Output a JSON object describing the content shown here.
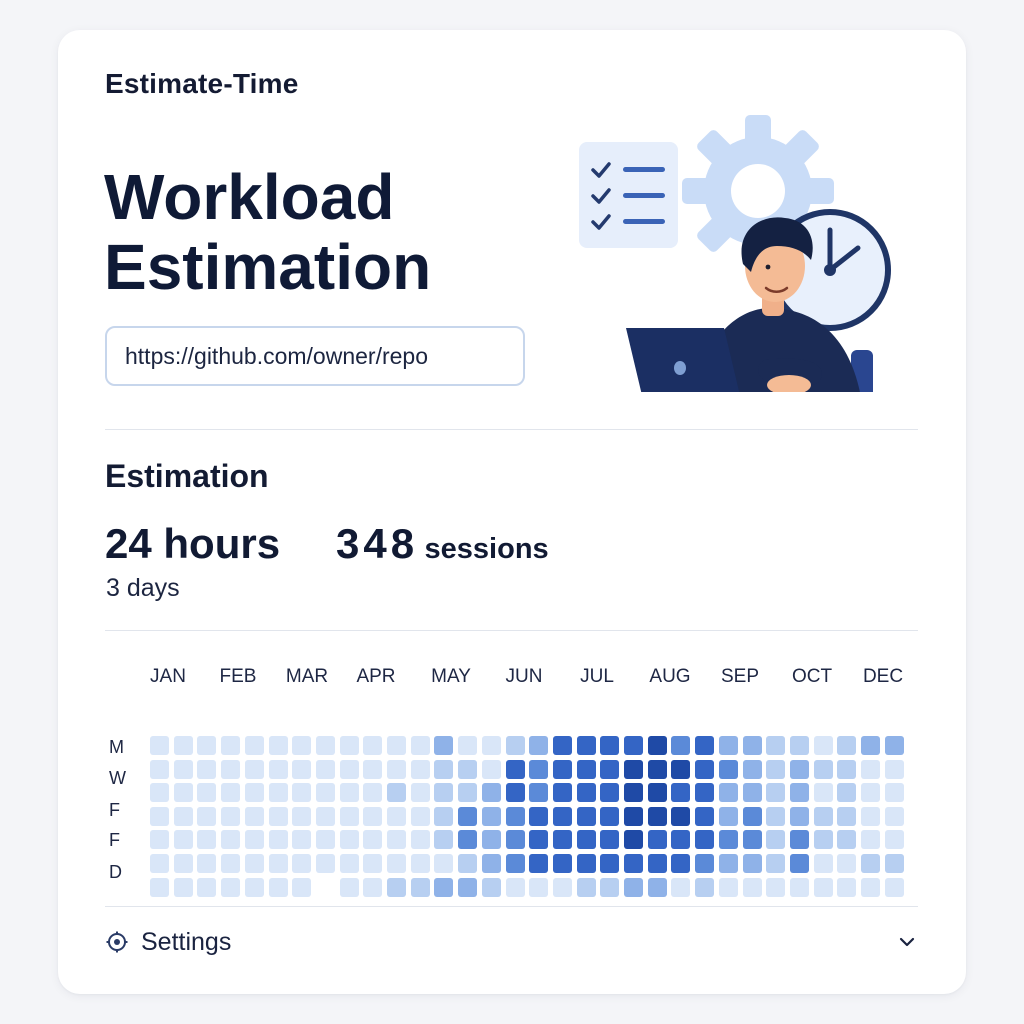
{
  "app": {
    "name": "Estimate-Time"
  },
  "hero": {
    "title_line1": "Workload",
    "title_line2": "Estimation",
    "repo_input_value": "https://github.com/owner/repo"
  },
  "estimation": {
    "section_title": "Estimation",
    "hours": "24 hours",
    "sessions_count": "348",
    "sessions_unit": "sessions",
    "days": "3 days"
  },
  "heatmap": {
    "months": [
      "JAN",
      "FEB",
      "MAR",
      "APR",
      "MAY",
      "JUN",
      "JUL",
      "AUG",
      "SEP",
      "OCT",
      "DEC"
    ],
    "row_labels": [
      "M",
      "W",
      "F",
      "F",
      "D"
    ],
    "palette": [
      "#eef3fb",
      "#d9e6f8",
      "#b7cff1",
      "#8fb2e8",
      "#5b8ad8",
      "#3465c5",
      "#1f4aa6"
    ],
    "levels": [
      [
        1,
        1,
        1,
        1,
        1,
        1,
        1,
        1,
        1,
        1,
        1,
        1,
        3,
        1,
        1,
        2,
        3,
        5,
        5,
        5,
        5,
        6,
        4,
        5,
        3,
        3,
        2,
        2,
        1,
        2,
        3,
        3
      ],
      [
        1,
        1,
        1,
        1,
        1,
        1,
        1,
        1,
        1,
        1,
        1,
        1,
        2,
        2,
        1,
        5,
        4,
        5,
        5,
        5,
        6,
        6,
        6,
        5,
        4,
        3,
        2,
        3,
        2,
        2,
        1,
        1
      ],
      [
        1,
        1,
        1,
        1,
        1,
        1,
        1,
        1,
        1,
        1,
        2,
        1,
        2,
        2,
        3,
        5,
        4,
        5,
        5,
        5,
        6,
        6,
        5,
        5,
        3,
        3,
        2,
        3,
        1,
        2,
        1,
        1
      ],
      [
        1,
        1,
        1,
        1,
        1,
        1,
        1,
        1,
        1,
        1,
        1,
        1,
        2,
        4,
        3,
        4,
        5,
        5,
        5,
        5,
        6,
        6,
        6,
        5,
        3,
        4,
        2,
        3,
        2,
        2,
        1,
        1
      ],
      [
        1,
        1,
        1,
        1,
        1,
        1,
        1,
        1,
        1,
        1,
        1,
        1,
        2,
        4,
        3,
        4,
        5,
        5,
        5,
        5,
        6,
        5,
        5,
        5,
        4,
        4,
        2,
        4,
        2,
        2,
        1,
        1
      ],
      [
        1,
        1,
        1,
        1,
        1,
        1,
        1,
        1,
        1,
        1,
        1,
        1,
        1,
        2,
        3,
        4,
        5,
        5,
        5,
        5,
        5,
        5,
        5,
        4,
        3,
        3,
        2,
        4,
        1,
        1,
        2,
        2
      ],
      [
        1,
        1,
        1,
        1,
        1,
        1,
        1,
        0,
        1,
        1,
        2,
        2,
        3,
        3,
        2,
        1,
        1,
        1,
        2,
        2,
        3,
        3,
        1,
        2,
        1,
        1,
        1,
        1,
        1,
        1,
        1,
        1
      ]
    ]
  },
  "settings": {
    "label": "Settings"
  },
  "icons": {
    "settings": "gear-icon",
    "expand": "chevron-down-icon",
    "illustration": "developer-illustration"
  }
}
